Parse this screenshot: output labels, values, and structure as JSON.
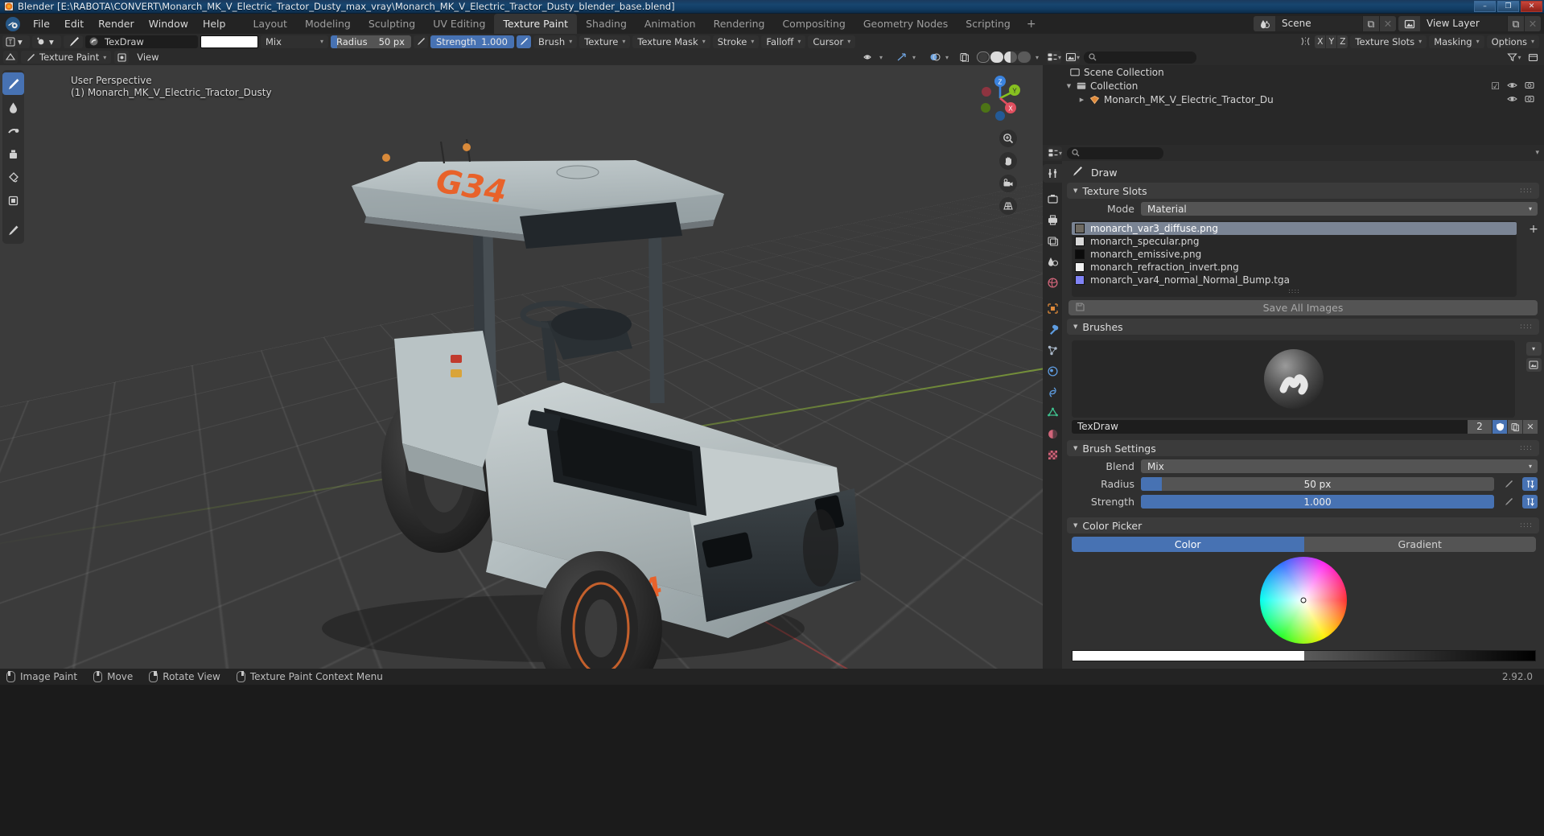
{
  "window": {
    "title": "Blender [E:\\RABOTA\\CONVERT\\Monarch_MK_V_Electric_Tractor_Dusty_max_vray\\Monarch_MK_V_Electric_Tractor_Dusty_blender_base.blend]",
    "minimize": "–",
    "maximize": "❐",
    "close": "✕"
  },
  "menu": {
    "items": [
      "File",
      "Edit",
      "Render",
      "Window",
      "Help"
    ]
  },
  "workspaces": {
    "tabs": [
      "Layout",
      "Modeling",
      "Sculpting",
      "UV Editing",
      "Texture Paint",
      "Shading",
      "Animation",
      "Rendering",
      "Compositing",
      "Geometry Nodes",
      "Scripting"
    ],
    "active": "Texture Paint",
    "add_label": "+"
  },
  "topbar_right": {
    "scene_name": "Scene",
    "view_layer_name": "View Layer",
    "new_label": "⧉",
    "unlink_label": "✕"
  },
  "tool_header": {
    "mode": "Texture Paint",
    "brush_name": "TexDraw",
    "color_hex": "#ffffff",
    "blend": "Mix",
    "radius_label": "Radius",
    "radius_value": "50 px",
    "radius_fill_pct": 8,
    "strength_label": "Strength",
    "strength_value": "1.000",
    "strength_fill_pct": 100,
    "menus": [
      "Brush",
      "Texture",
      "Texture Mask",
      "Stroke",
      "Falloff",
      "Cursor"
    ],
    "symmetry_axes": [
      "X",
      "Y",
      "Z"
    ],
    "right_menus": [
      "Texture Slots",
      "Masking",
      "Options"
    ]
  },
  "viewport": {
    "header_mode": "Texture Paint",
    "header_view": "View",
    "perspective_label": "User Perspective",
    "object_label": "(1) Monarch_MK_V_Electric_Tractor_Dusty",
    "gizmo_axes": [
      "X",
      "Y",
      "Z"
    ],
    "background": "#3b3b3b"
  },
  "outliner": {
    "rows": [
      {
        "label": "Scene Collection",
        "indent": 0,
        "type": "scene-collection"
      },
      {
        "label": "Collection",
        "indent": 1,
        "type": "collection"
      },
      {
        "label": "Monarch_MK_V_Electric_Tractor_Du",
        "indent": 2,
        "type": "mesh-object"
      }
    ]
  },
  "properties": {
    "tool_title": "Draw",
    "texture_slots": {
      "title": "Texture Slots",
      "mode_label": "Mode",
      "mode_value": "Material",
      "slots": [
        {
          "name": "monarch_var3_diffuse.png",
          "swatch": "#6e6a62",
          "selected": true
        },
        {
          "name": "monarch_specular.png",
          "swatch": "#d8d8d8",
          "selected": false
        },
        {
          "name": "monarch_emissive.png",
          "swatch": "#0b0b0b",
          "selected": false
        },
        {
          "name": "monarch_refraction_invert.png",
          "swatch": "#f2f2f2",
          "selected": false
        },
        {
          "name": "monarch_var4_normal_Normal_Bump.tga",
          "swatch": "#8083f5",
          "selected": false
        }
      ],
      "save_all_label": "Save All Images"
    },
    "brushes": {
      "title": "Brushes",
      "brush_name": "TexDraw",
      "users_count": "2"
    },
    "brush_settings": {
      "title": "Brush Settings",
      "blend_label": "Blend",
      "blend_value": "Mix",
      "radius_label": "Radius",
      "radius_value": "50 px",
      "radius_fill_pct": 6,
      "strength_label": "Strength",
      "strength_value": "1.000",
      "strength_fill_pct": 100
    },
    "color_picker": {
      "title": "Color Picker",
      "tab_color": "Color",
      "tab_gradient": "Gradient",
      "active_tab": "Color"
    }
  },
  "status_bar": {
    "items": [
      {
        "mouse": "left",
        "label": "Image Paint"
      },
      {
        "mouse": "middle",
        "label": "Move"
      },
      {
        "mouse": "right-drag",
        "label": "Rotate View"
      },
      {
        "mouse": "right",
        "label": "Texture Paint Context Menu"
      }
    ],
    "version": "2.92.0"
  }
}
